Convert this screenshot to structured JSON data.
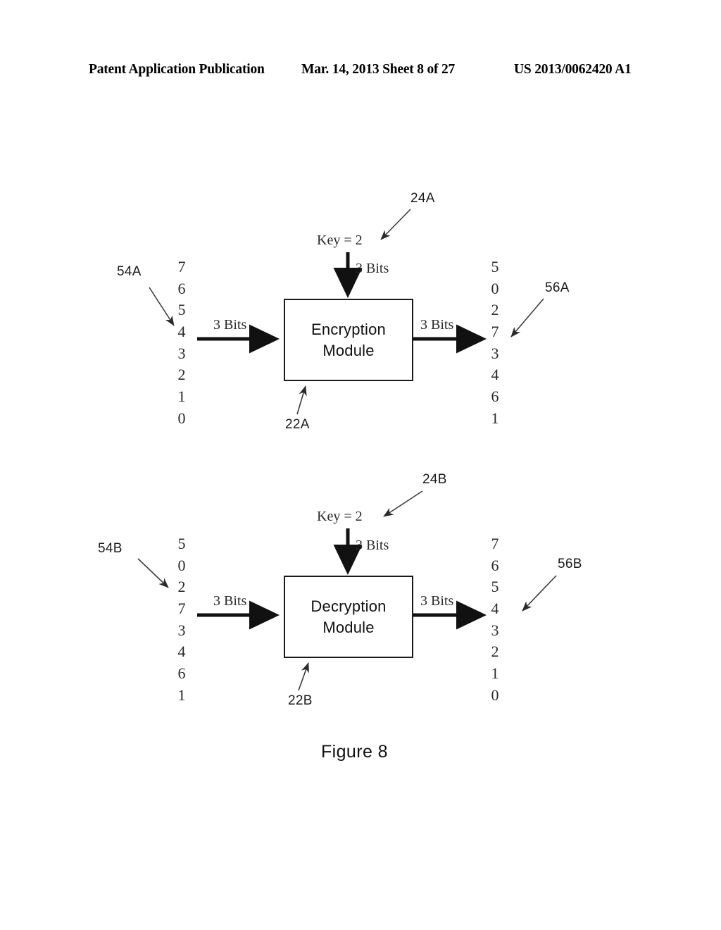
{
  "header": {
    "left": "Patent Application Publication",
    "middle": "Mar. 14, 2013  Sheet 8 of 27",
    "right": "US 2013/0062420 A1"
  },
  "figure": {
    "caption": "Figure 8"
  },
  "diagrams": [
    {
      "id": "encryption",
      "module_label_line1": "Encryption",
      "module_label_line2": "Module",
      "module_ref": "22A",
      "key_label": "Key = 2",
      "key_ref": "24A",
      "key_bus_label": "3 Bits",
      "input_ref": "54A",
      "input_bus_label": "3 Bits",
      "input_values": [
        "7",
        "6",
        "5",
        "4",
        "3",
        "2",
        "1",
        "0"
      ],
      "output_ref": "56A",
      "output_bus_label": "3 Bits",
      "output_values": [
        "5",
        "0",
        "2",
        "7",
        "3",
        "4",
        "6",
        "1"
      ]
    },
    {
      "id": "decryption",
      "module_label_line1": "Decryption",
      "module_label_line2": "Module",
      "module_ref": "22B",
      "key_label": "Key = 2",
      "key_ref": "24B",
      "key_bus_label": "3 Bits",
      "input_ref": "54B",
      "input_bus_label": "3 Bits",
      "input_values": [
        "5",
        "0",
        "2",
        "7",
        "3",
        "4",
        "6",
        "1"
      ],
      "output_ref": "56B",
      "output_bus_label": "3 Bits",
      "output_values": [
        "7",
        "6",
        "5",
        "4",
        "3",
        "2",
        "1",
        "0"
      ]
    }
  ],
  "colors": {
    "ink": "#000000",
    "paper": "#ffffff",
    "line": "#1a1a1a"
  }
}
